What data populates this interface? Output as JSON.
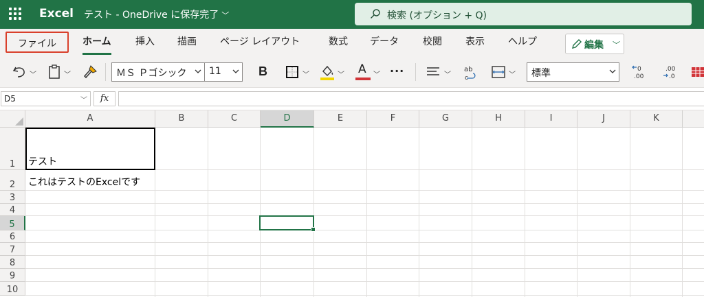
{
  "titlebar": {
    "app_name": "Excel",
    "doc_title": "テスト - OneDrive に保存完了",
    "search_label": "検索 (オプション + Q)",
    "bg_color": "#217346"
  },
  "ribbon": {
    "tabs": [
      {
        "label": "ファイル"
      },
      {
        "label": "ホーム"
      },
      {
        "label": "挿入"
      },
      {
        "label": "描画"
      },
      {
        "label": "ページ レイアウト"
      },
      {
        "label": "数式"
      },
      {
        "label": "データ"
      },
      {
        "label": "校閲"
      },
      {
        "label": "表示"
      },
      {
        "label": "ヘルプ"
      }
    ],
    "edit_button": "編集"
  },
  "toolbar": {
    "font_name": "ＭＳ Ｐゴシック",
    "font_size": "11",
    "bold_label": "B",
    "font_color_label": "A",
    "more_label": "···",
    "number_format": "標準",
    "fill_color": "#f2d600",
    "font_color": "#d13438"
  },
  "formula_bar": {
    "name_box": "D5",
    "fx_label": "fx",
    "formula": ""
  },
  "grid": {
    "columns": [
      "A",
      "B",
      "C",
      "D",
      "E",
      "F",
      "G",
      "H",
      "I",
      "J",
      "K"
    ],
    "rows": [
      "1",
      "2",
      "3",
      "4",
      "5",
      "6",
      "7",
      "8",
      "9",
      "10"
    ],
    "active_column": "D",
    "active_row": "5",
    "cells": {
      "A1": "テスト",
      "A2": "これはテストのExcelです"
    }
  }
}
